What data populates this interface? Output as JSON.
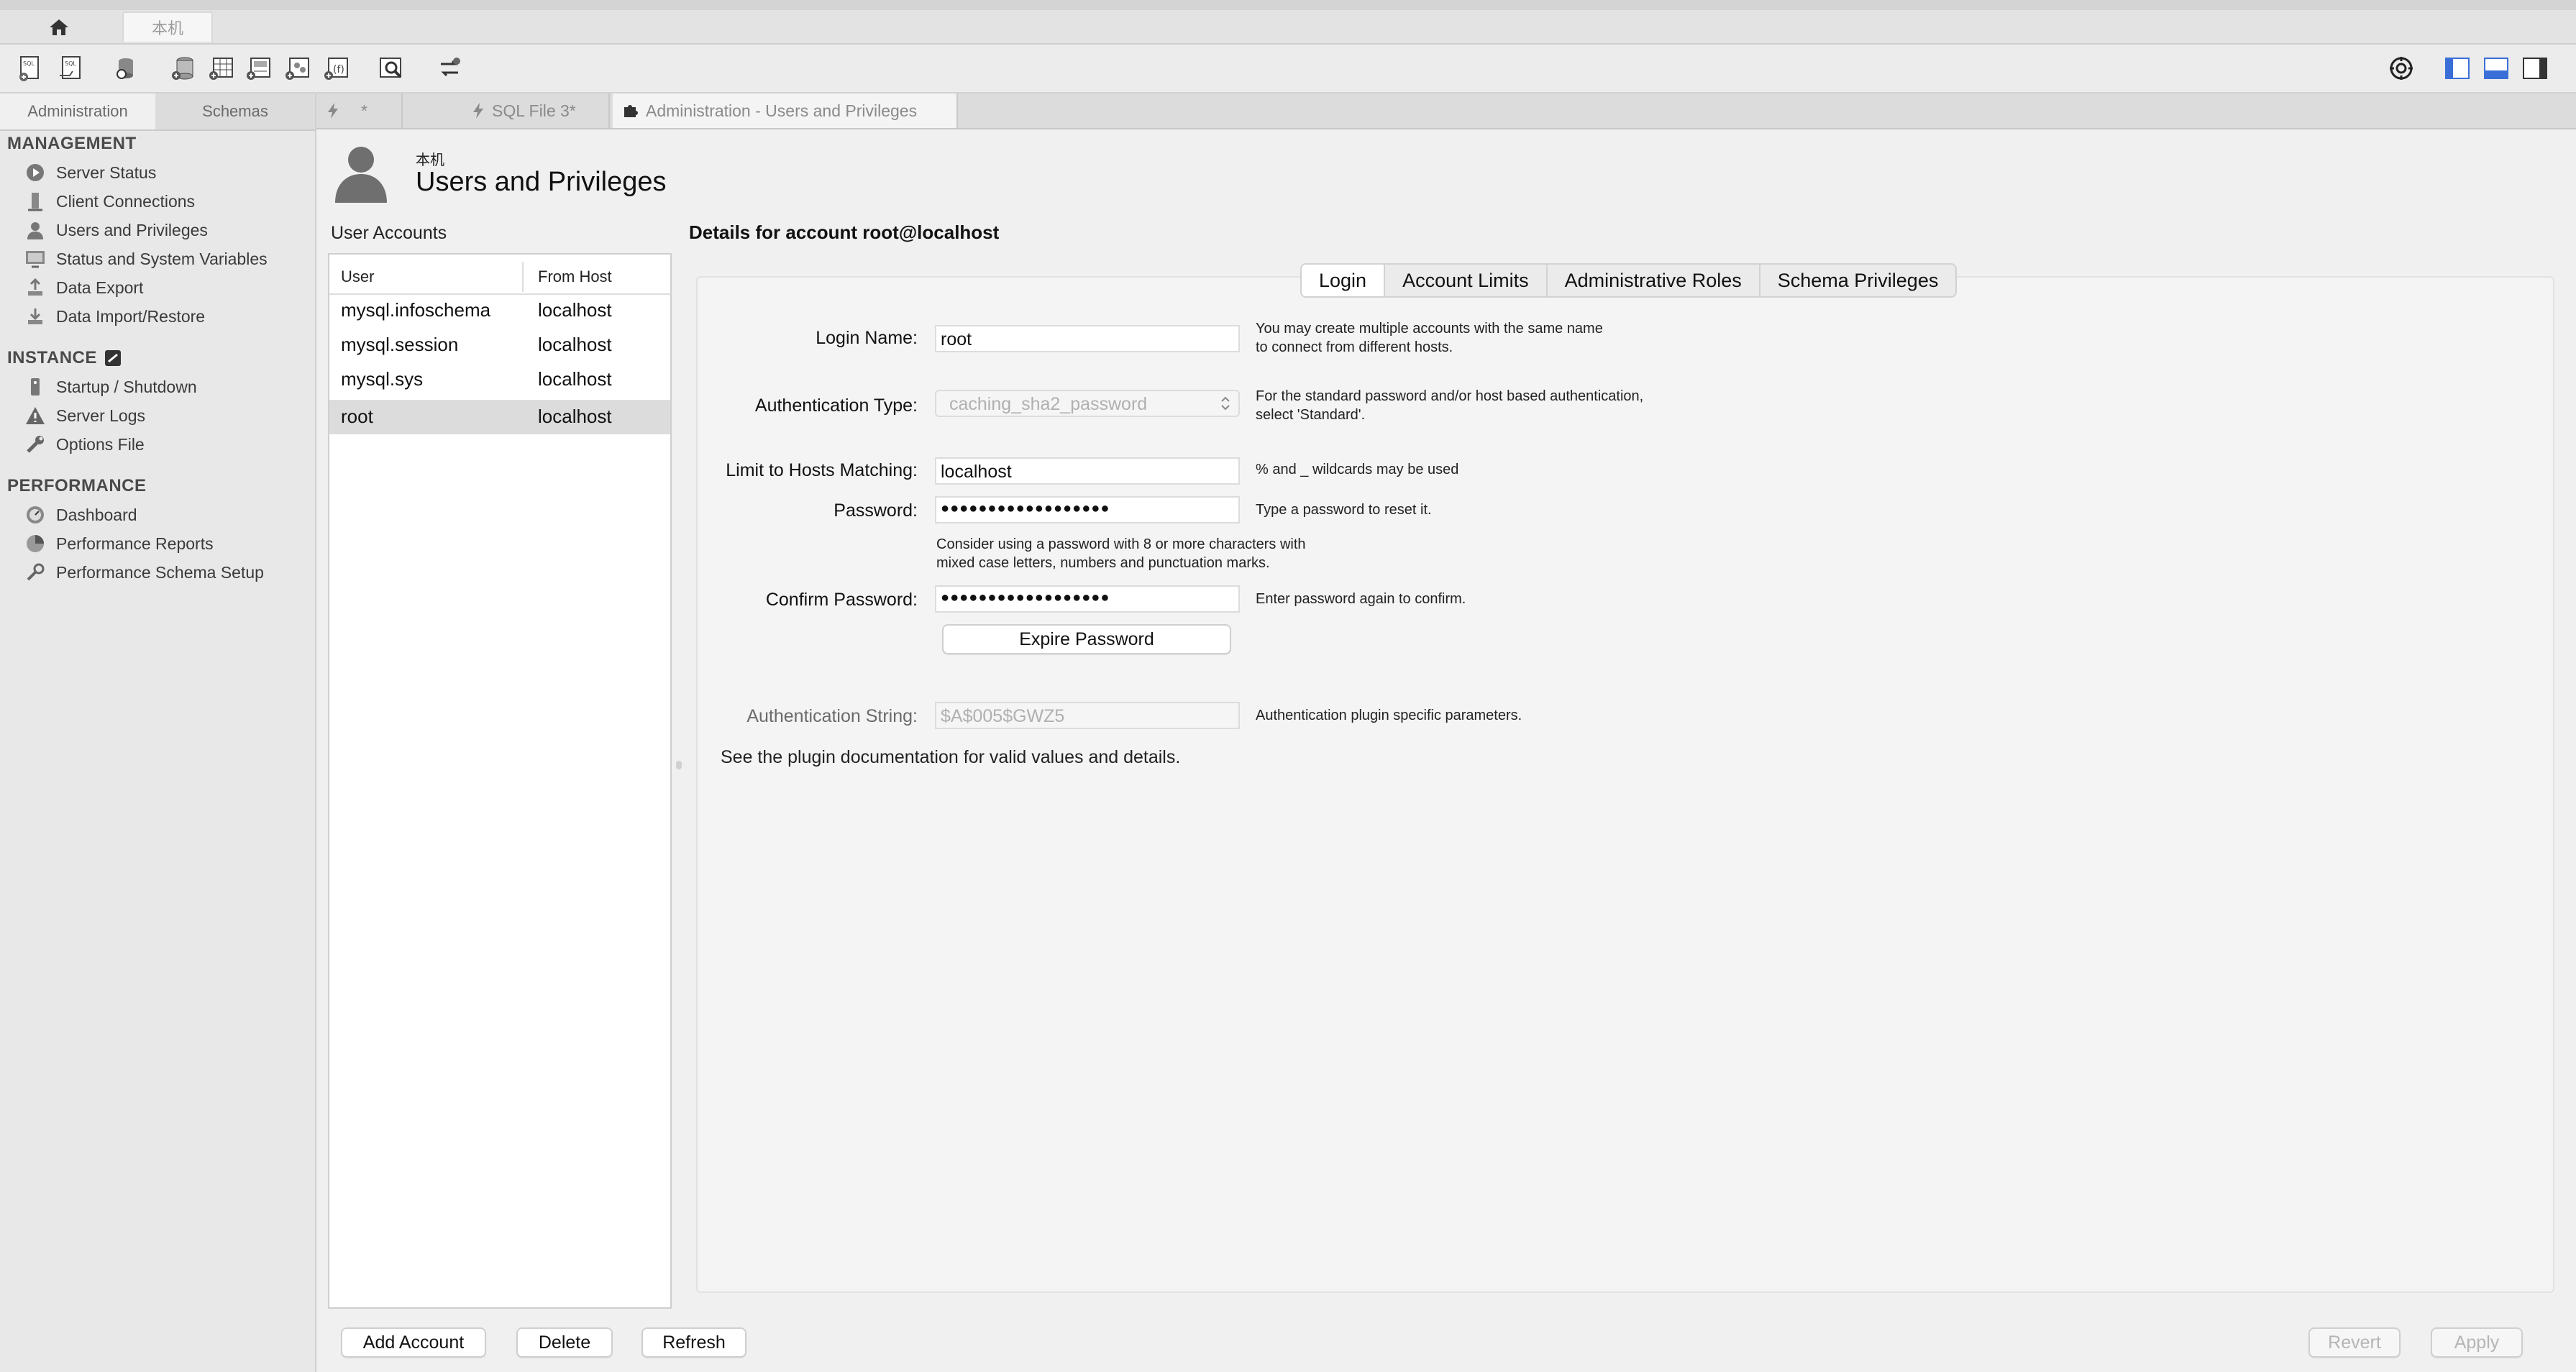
{
  "window": {
    "connection_tab": "本机"
  },
  "icons": {
    "home": "home-icon",
    "toolbar": [
      "new-sql-tab-icon",
      "open-sql-script-icon",
      "open-inspector-icon",
      "create-schema-icon",
      "create-table-icon",
      "create-view-icon",
      "create-procedure-icon",
      "create-function-icon",
      "search-table-data-icon",
      "reconnect-icon"
    ],
    "right": [
      "settings-gear-icon",
      "toggle-sidebar-icon",
      "toggle-output-icon",
      "toggle-secondary-sidebar-icon"
    ]
  },
  "sidebar": {
    "tabs": [
      "Administration",
      "Schemas"
    ],
    "sections": [
      {
        "title": "MANAGEMENT",
        "items": [
          "Server Status",
          "Client Connections",
          "Users and Privileges",
          "Status and System Variables",
          "Data Export",
          "Data Import/Restore"
        ]
      },
      {
        "title": "INSTANCE",
        "items": [
          "Startup / Shutdown",
          "Server Logs",
          "Options File"
        ]
      },
      {
        "title": "PERFORMANCE",
        "items": [
          "Dashboard",
          "Performance Reports",
          "Performance Schema Setup"
        ]
      }
    ]
  },
  "editor_tabs": [
    "*",
    "SQL File 3*",
    "Administration - Users and Privileges"
  ],
  "page": {
    "subtitle": "本机",
    "title": "Users and Privileges"
  },
  "accounts": {
    "label": "User Accounts",
    "columns": [
      "User",
      "From Host"
    ],
    "rows": [
      {
        "user": "mysql.infoschema",
        "host": "localhost"
      },
      {
        "user": "mysql.session",
        "host": "localhost"
      },
      {
        "user": "mysql.sys",
        "host": "localhost"
      },
      {
        "user": "root",
        "host": "localhost"
      }
    ],
    "selected_index": 3
  },
  "details": {
    "label": "Details for account root@localhost",
    "tabs": [
      "Login",
      "Account Limits",
      "Administrative Roles",
      "Schema Privileges"
    ],
    "active_tab": "Login",
    "form": {
      "login_name_label": "Login Name:",
      "login_name_value": "root",
      "login_name_hint": "You may create multiple accounts with the same name\nto connect from different hosts.",
      "auth_type_label": "Authentication Type:",
      "auth_type_value": "caching_sha2_password",
      "auth_type_hint": "For the standard password and/or host based authentication,\nselect 'Standard'.",
      "hosts_label": "Limit to Hosts Matching:",
      "hosts_value": "localhost",
      "hosts_hint": "% and _ wildcards may be used",
      "password_label": "Password:",
      "password_value": "●●●●●●●●●●●●●●●●●●",
      "password_hint": "Type a password to reset it.",
      "password_note": "Consider using a password with 8 or more characters with\nmixed case letters, numbers and punctuation marks.",
      "confirm_label": "Confirm Password:",
      "confirm_value": "●●●●●●●●●●●●●●●●●●",
      "confirm_hint": "Enter password again to confirm.",
      "expire_button": "Expire Password",
      "auth_string_label": "Authentication String:",
      "auth_string_value": "$A$005$GWZ5",
      "auth_string_hint": "Authentication plugin specific parameters.",
      "plugin_note": "See the plugin documentation for valid values and details."
    }
  },
  "bottom_buttons": {
    "add": "Add Account",
    "delete": "Delete",
    "refresh": "Refresh",
    "revert": "Revert",
    "apply": "Apply"
  },
  "colors": {
    "accent_blue": "#3b6fd8",
    "selection_gray": "#dcdcdc"
  }
}
